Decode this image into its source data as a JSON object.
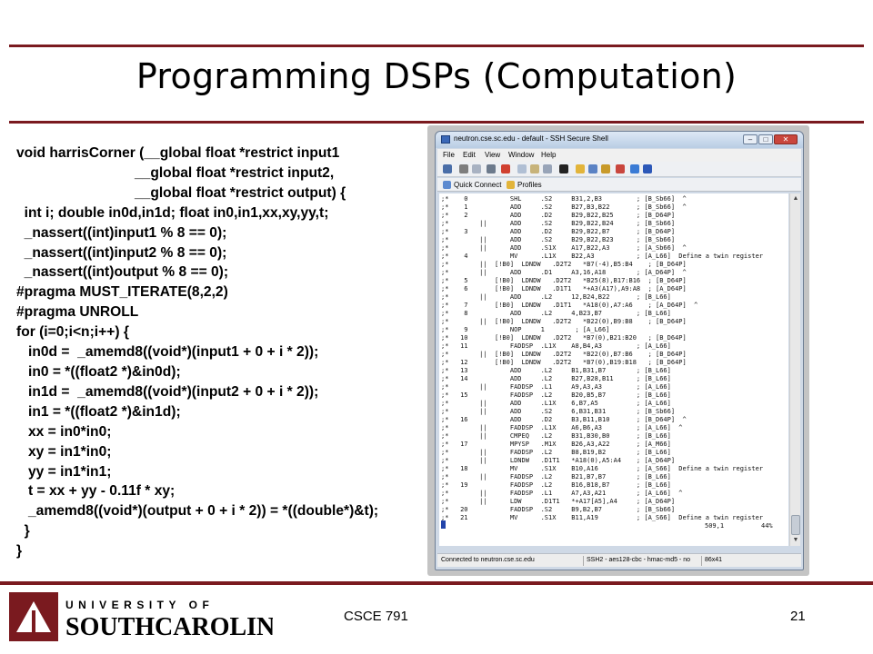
{
  "slide": {
    "title": "Programming DSPs (Computation)",
    "code_lines": [
      "void harrisCorner (__global float *restrict input1",
      "                              __global float *restrict input2,",
      "                              __global float *restrict output) {",
      "  int i; double in0d,in1d; float in0,in1,xx,xy,yy,t;",
      "  _nassert((int)input1 % 8 == 0);",
      "  _nassert((int)input2 % 8 == 0);",
      "  _nassert((int)output % 8 == 0);",
      "#pragma MUST_ITERATE(8,2,2)",
      "#pragma UNROLL",
      "for (i=0;i<n;i++) {",
      "   in0d =  _amemd8((void*)(input1 + 0 + i * 2));",
      "   in0 = *((float2 *)&in0d);",
      "   in1d =  _amemd8((void*)(input2 + 0 + i * 2));",
      "   in1 = *((float2 *)&in1d);",
      "   xx = in0*in0;",
      "   xy = in1*in0;",
      "   yy = in1*in1;",
      "   t = xx + yy - 0.11f * xy;",
      "   _amemd8((void*)(output + 0 + i * 2)) = *((double*)&t);",
      "  }",
      "}"
    ]
  },
  "ssh_window": {
    "title": "neutron.cse.sc.edu - default - SSH Secure Shell",
    "window_buttons": {
      "minimize": "–",
      "maximize": "□",
      "close": "✕"
    },
    "menu": [
      "File",
      "Edit",
      "View",
      "Window",
      "Help"
    ],
    "quick_connect_label": "Quick Connect",
    "profiles_label": "Profiles",
    "terminal_lines": [
      ";*    0           SHL     .S2     B31,2,B3         ; [B_Sb66]  ^",
      ";*    1           ADD     .S2     B27,B3,B22       ; [B_Sb66]  ^",
      ";*    2           ADD     .D2     B29,B22,B25      ; [B_D64P]",
      ";*        ||      ADD     .S2     B29,B22,B24      ; [B_Sb66]",
      ";*    3           ADD     .D2     B29,B22,B7       ; [B_D64P]",
      ";*        ||      ADD     .S2     B29,B22,B23      ; [B_Sb66]",
      ";*        ||      ADD     .S1X    A17,B22,A3       ; [A_Sb66]  ^",
      ";*    4           MV      .L1X    B22,A3           ; [A_L66]  Define a twin register",
      ";*        ||  [!B0]  LDNDW   .D2T2   *B7(-4),B5:B4    ; [B_D64P]",
      ";*        ||      ADD     .D1     A3,16,A18        ; [A_D64P]  ^",
      ";*    5       [!B0]  LDNDW   .D2T2   *B25(8),B17:B16  ; [B_D64P]",
      ";*    6       [!B0]  LDNDW   .D1T1   *+A3(A17),A9:A8  ; [A_D64P]",
      ";*        ||      ADD     .L2     12,B24,B22       ; [B_L66]",
      ";*    7       [!B0]  LDNDW   .D1T1   *A18(0),A7:A6    ; [A_D64P]  ^",
      ";*    8           ADD     .L2     4,B23,B7         ; [B_L66]",
      ";*        ||  [!B0]  LDNDW   .D2T2   *B22(0),B9:B8    ; [B_D64P]",
      ";*    9           NOP     1        ; [A_L66]",
      ";*   10       [!B0]  LDNDW   .D2T2   *B7(0),B21:B20   ; [B_D64P]",
      ";*   11           FADDSP  .L1X    A8,B4,A3         ; [A_L66]",
      ";*        ||  [!B0]  LDNDW   .D2T2   *B22(0),B7:B6    ; [B_D64P]",
      ";*   12       [!B0]  LDNDW   .D2T2   *B7(0),B19:B18   ; [B_D64P]",
      ";*   13           ADD     .L2     B1,B31,B7        ; [B_L66]",
      ";*   14           ADD     .L2     B27,B28,B11      ; [B_L66]",
      ";*        ||      FADDSP  .L1     A9,A3,A3         ; [A_L66]",
      ";*   15           FADDSP  .L2     B20,B5,B7        ; [B_L66]",
      ";*        ||      ADD     .L1X    6,B7,A5          ; [A_L66]",
      ";*        ||      ADD     .S2     6,B31,B31        ; [B_Sb66]",
      ";*   16           ADD     .D2     B3,B11,B10       ; [B_D64P]  ^",
      ";*        ||      FADDSP  .L1X    A6,B6,A3         ; [A_L66]  ^",
      ";*        ||      CMPEQ   .L2     B31,B30,B0       ; [B_L66]",
      ";*   17           MPYSP   .M1X    B26,A3,A22       ; [A_M66]",
      ";*        ||      FADDSP  .L2     B8,B19,B2        ; [B_L66]",
      ";*        ||      LDNDW   .D1T1   *A18(0),A5:A4    ; [A_D64P]",
      ";*   18           MV      .S1X    B10,A16          ; [A_S66]  Define a twin register",
      ";*        ||      FADDSP  .L2     B21,B7,B7        ; [B_L66]",
      ";*   19           FADDSP  .L2     B16,B18,B7       ; [B_L66]",
      ";*        ||      FADDSP  .L1     A7,A3,A21        ; [A_L66]  ^",
      ";*        ||      LDW     .D1T1   *+A17[A5],A4     ; [A_D64P]",
      ";*   20           FADDSP  .S2     B9,B2,B7         ; [B_Sb66]",
      ";*   21           MV      .S1X    B11,A19          ; [A_S66]  Define a twin register"
    ],
    "cursor_position": "509,1",
    "scroll_percent": "44%",
    "status_connection": "Connected to neutron.cse.sc.edu",
    "status_cipher": "SSH2 - aes128-cbc - hmac-md5 - no",
    "status_size": "86x41"
  },
  "footer": {
    "university_top": "UNIVERSITY OF",
    "university_bottom": "SOUTHCAROLINA",
    "course": "CSCE 791",
    "page_number": "21"
  },
  "colors": {
    "garnet": "#7a1a1f",
    "black": "#000000"
  }
}
